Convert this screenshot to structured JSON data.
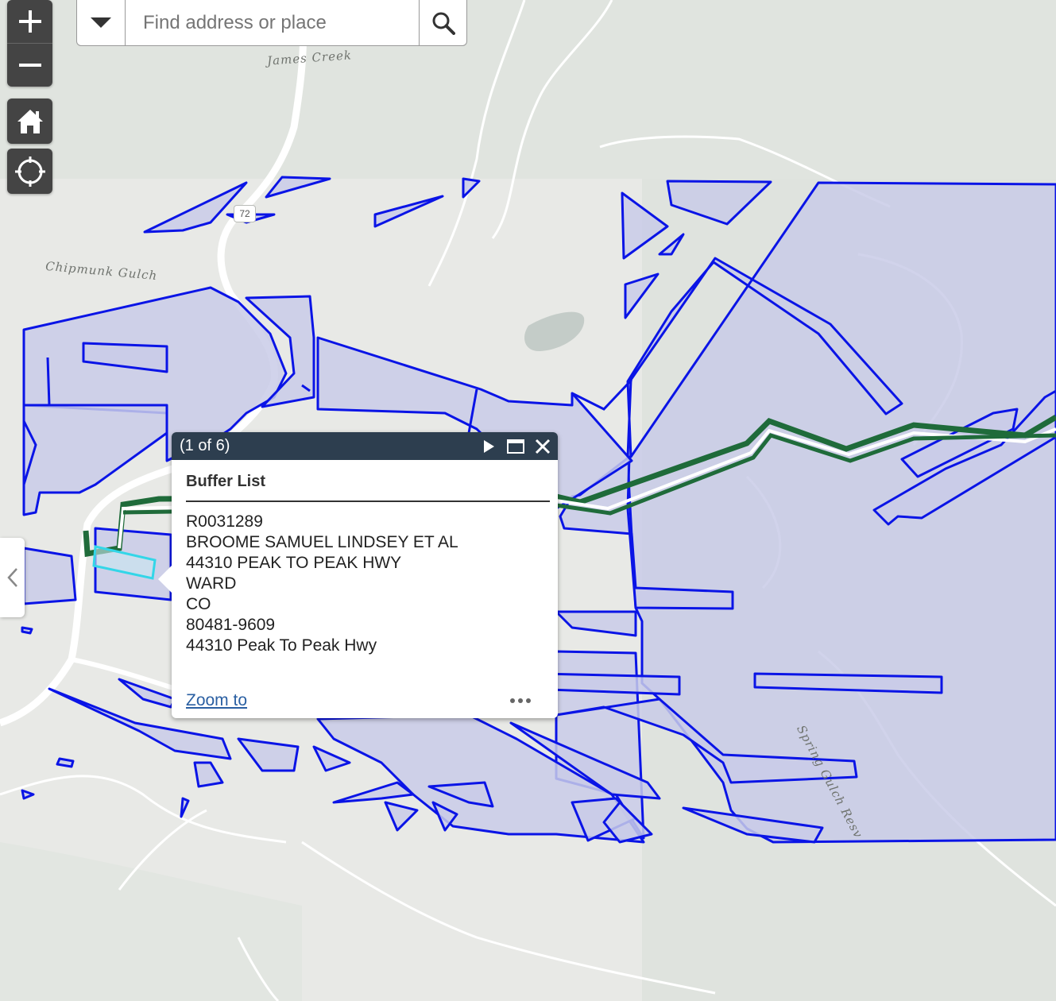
{
  "search": {
    "placeholder": "Find address or place"
  },
  "map_labels": {
    "james_creek": "James Creek",
    "chipmunk_gulch": "Chipmunk Gulch",
    "spring_gulch_resv": "Spring Gulch Resv",
    "highway_shield": "72"
  },
  "controls": {
    "zoom_in_icon": "plus-icon",
    "zoom_out_icon": "minus-icon",
    "home_icon": "home-icon",
    "locate_icon": "locate-icon"
  },
  "popup": {
    "count": "(1 of 6)",
    "title": "Buffer List",
    "lines": [
      "R0031289",
      "BROOME SAMUEL LINDSEY ET AL",
      "44310 PEAK TO PEAK HWY",
      "WARD",
      "CO",
      "80481-9609",
      "44310 Peak To Peak Hwy"
    ],
    "zoom_to": "Zoom to"
  },
  "colors": {
    "parcel_stroke": "#0a14e6",
    "parcel_fill": "#c9cbe8",
    "route_green": "#1f6b3a",
    "highlight_cyan": "#33d6e8",
    "popup_header": "#2d3e4f"
  }
}
